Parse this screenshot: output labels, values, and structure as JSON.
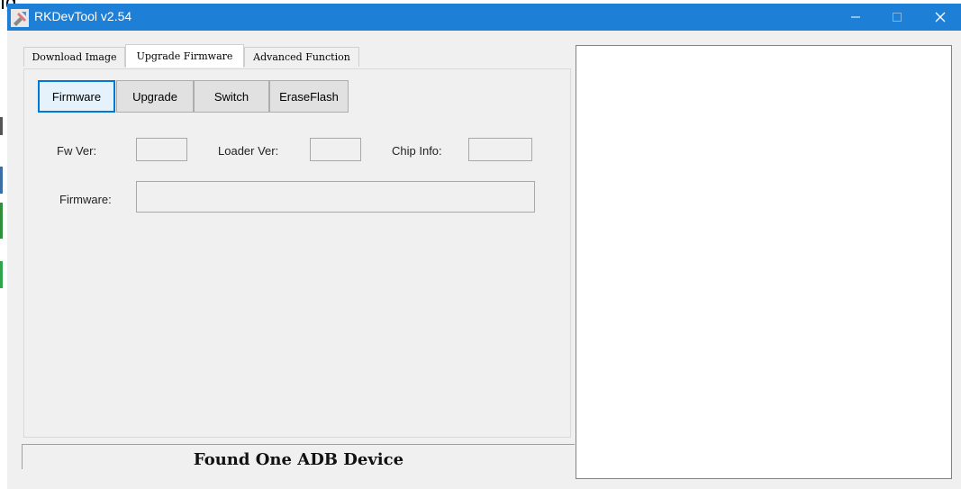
{
  "app": {
    "title": "RKDevTool v2.54",
    "accent_color": "#1e7fd6"
  },
  "window_controls": {
    "minimize_icon": "minimize-icon",
    "maximize_icon": "maximize-icon",
    "close_icon": "close-icon"
  },
  "tabs": [
    {
      "label": "Download Image",
      "active": false
    },
    {
      "label": "Upgrade Firmware",
      "active": true
    },
    {
      "label": "Advanced Function",
      "active": false
    }
  ],
  "buttons": {
    "firmware": "Firmware",
    "upgrade": "Upgrade",
    "switch": "Switch",
    "erase_flash": "EraseFlash"
  },
  "fields": {
    "fw_ver_label": "Fw Ver:",
    "fw_ver_value": "",
    "loader_ver_label": "Loader Ver:",
    "loader_ver_value": "",
    "chip_info_label": "Chip Info:",
    "chip_info_value": "",
    "firmware_label": "Firmware:",
    "firmware_path": ""
  },
  "status": {
    "message": "Found One ADB Device"
  },
  "log": {
    "content": ""
  }
}
